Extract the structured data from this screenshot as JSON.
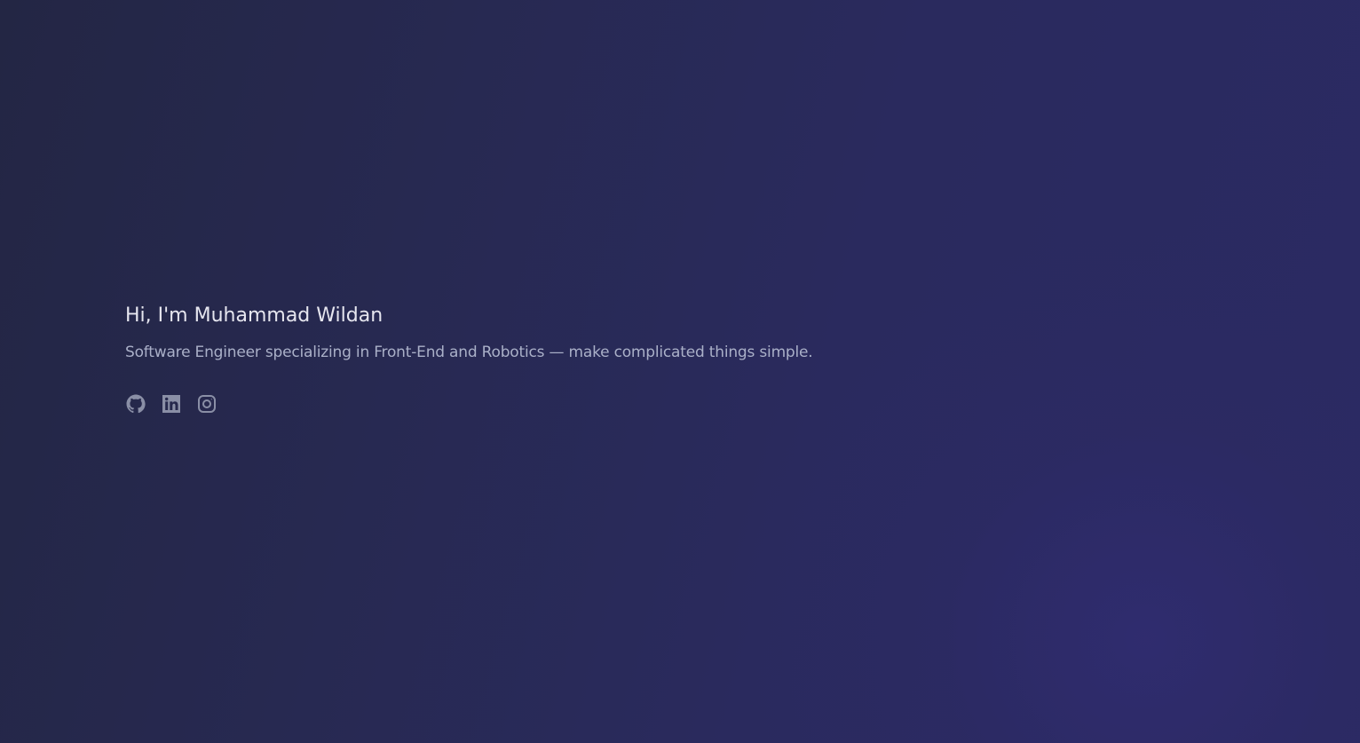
{
  "hero": {
    "title": "Hi, I'm Muhammad Wildan",
    "subtitle": "Software Engineer specializing in Front-End and Robotics — make complicated things simple."
  },
  "social": {
    "icons": [
      "github-icon",
      "linkedin-icon",
      "instagram-icon"
    ],
    "icon_color": "#8a8fa6"
  },
  "colors": {
    "background": "#272951",
    "title": "#e6e6ef",
    "subtitle": "#aab0c8"
  }
}
